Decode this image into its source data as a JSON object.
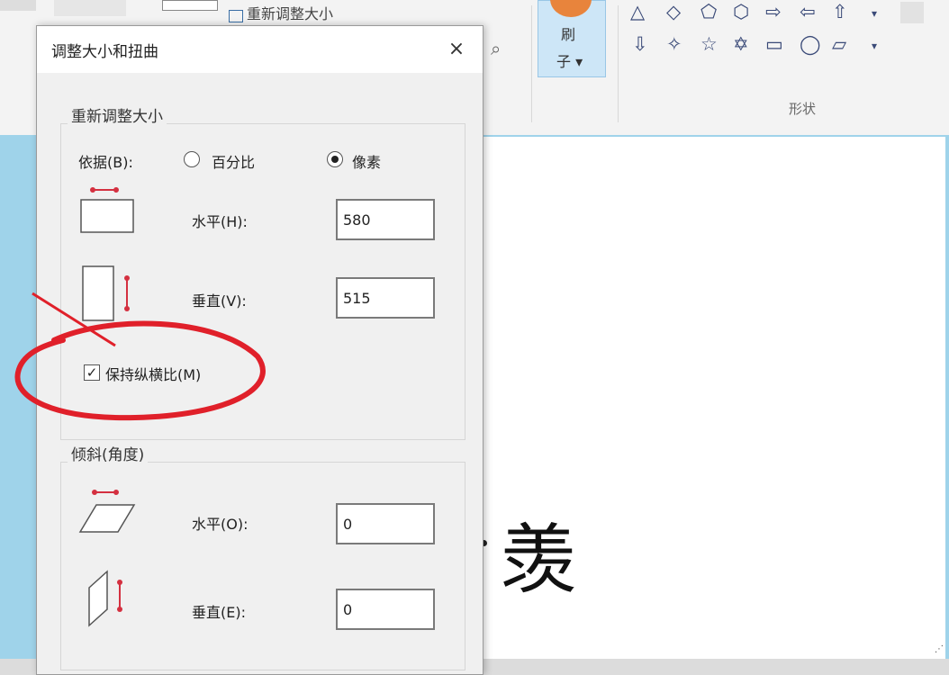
{
  "ribbon": {
    "resize_label": "重新调整大小",
    "brush_label_1": "刷",
    "brush_label_2": "子 ▾",
    "shapes_group_label": "形状",
    "shapes_more": "▾",
    "shapes_row1": [
      "△",
      "◇",
      "⬠",
      "⬡",
      "⇨",
      "⇦",
      "⇧"
    ],
    "shapes_row2": [
      "⇩",
      "✧",
      "☆",
      "✡",
      "▭",
      "◯",
      "▱"
    ]
  },
  "dialog": {
    "title": "调整大小和扭曲",
    "close_label": "×",
    "resize": {
      "legend": "重新调整大小",
      "by_label": "依据(B):",
      "percent_label": "百分比",
      "pixels_label": "像素",
      "selected_unit": "pixels",
      "horizontal_label": "水平(H):",
      "horizontal_value": "580",
      "vertical_label": "垂直(V):",
      "vertical_value": "515",
      "keep_aspect_label": "保持纵横比(M)",
      "keep_aspect_checked": "✓"
    },
    "skew": {
      "legend": "倾斜(角度)",
      "horizontal_label": "水平(O):",
      "horizontal_value": "0",
      "vertical_label": "垂直(E):",
      "vertical_value": "0"
    }
  },
  "canvas": {
    "character": "羡"
  },
  "colors": {
    "annotation": "#e0202a",
    "accent_handle": "#d43040",
    "ribbon_bg": "#f3f3f3",
    "canvas_bg": "#9fd3ea"
  }
}
